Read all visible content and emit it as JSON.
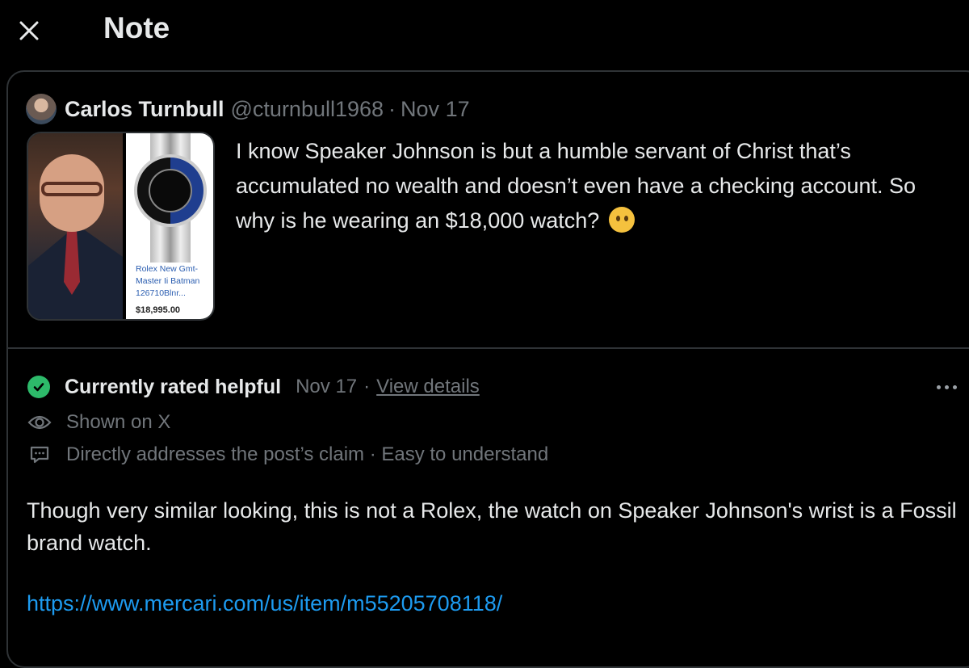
{
  "header": {
    "title": "Note",
    "close_icon": "close-icon"
  },
  "post": {
    "author_name": "Carlos Turnbull",
    "author_handle": "@cturnbull1968",
    "separator": "·",
    "date": "Nov 17",
    "text": "I know Speaker Johnson is but a humble servant of Christ that’s accumulated no wealth and doesn’t even have a checking account. So why is he wearing an $18,000 watch?",
    "emoji_icon": "thinking-face-icon",
    "media": {
      "product_name": "Rolex New Gmt-Master Ii Batman 126710Blnr...",
      "product_price": "$18,995.00"
    }
  },
  "note": {
    "status": "Currently rated helpful",
    "date": "Nov 17",
    "separator": "·",
    "view_details": "View details",
    "shown_on": "Shown on X",
    "reasons": "Directly addresses the post’s claim · Easy to understand",
    "body": "Though very similar looking, this is not a Rolex, the watch on Speaker Johnson's wrist is a Fossil brand watch.",
    "link": "https://www.mercari.com/us/item/m55205708118/",
    "colors": {
      "helpful_green": "#2dba6a",
      "link_blue": "#1d9bf0"
    }
  }
}
